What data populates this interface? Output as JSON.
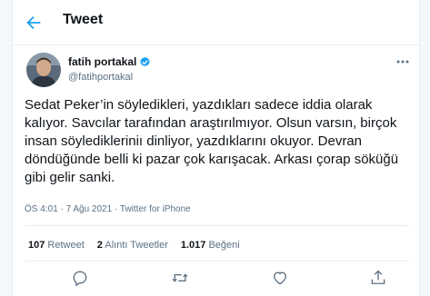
{
  "header": {
    "title": "Tweet"
  },
  "author": {
    "name": "fatih portakal",
    "handle": "@fatihportakal"
  },
  "tweet": {
    "text": "Sedat Peker’in söyledikleri, yazdıkları sadece iddia olarak kalıyor. Savcılar tarafından araştırılmıyor. Olsun varsın, birçok insan söyledikleriniı dinliyor, yazdıklarını okuyor. Devran döndüğünde belli ki pazar çok karışacak. Arkası çorap söküğü gibi gelir sanki.",
    "meta": "ÖS 4:01 · 7 Ağu 2021 · Twitter for iPhone"
  },
  "stats": {
    "retweets_count": "107",
    "retweets_label": "Retweet",
    "quotes_count": "2",
    "quotes_label": "Alıntı Tweetler",
    "likes_count": "1.017",
    "likes_label": "Beğeni"
  },
  "colors": {
    "accent": "#1da1f2",
    "muted": "#5b7083",
    "border": "#ebeef0"
  }
}
